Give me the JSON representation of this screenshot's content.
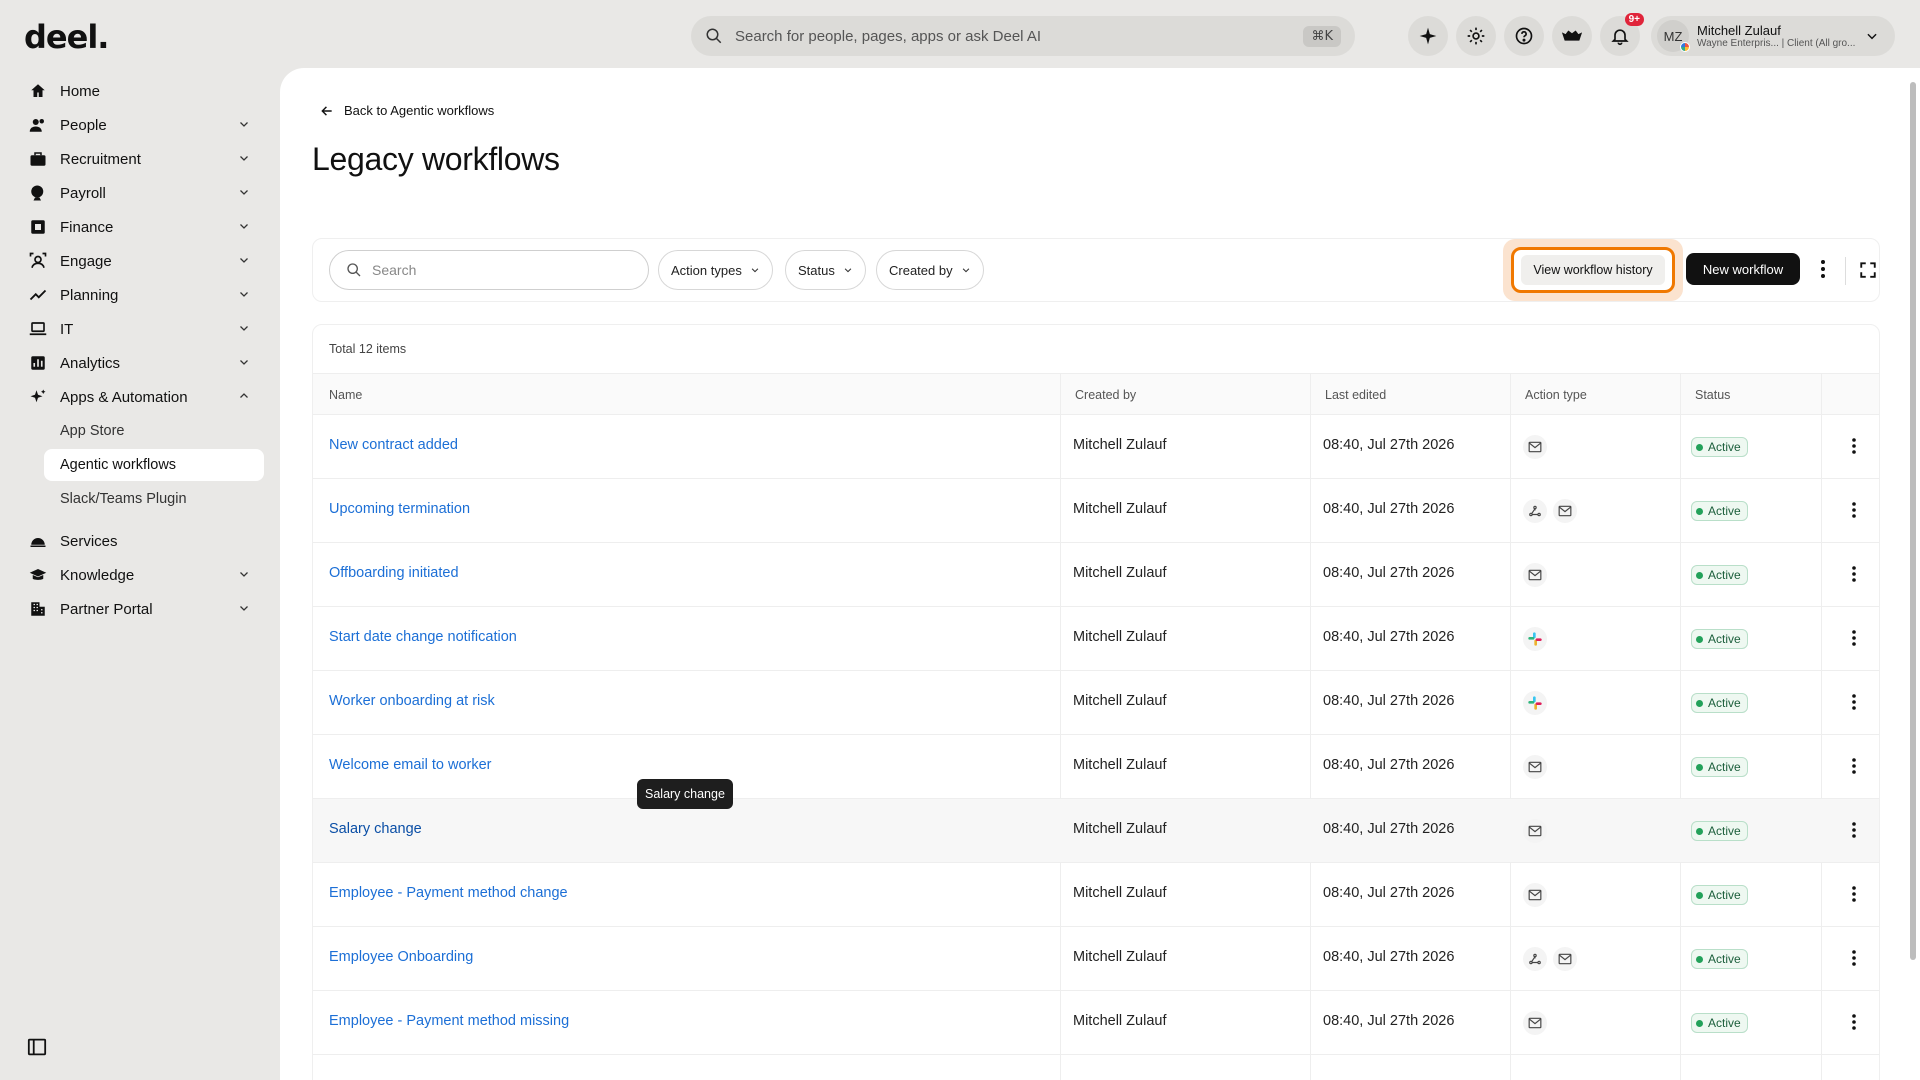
{
  "app": {
    "logo": "deel."
  },
  "search": {
    "placeholder": "Search for people, pages, apps or ask Deel AI",
    "shortcut": "⌘K"
  },
  "topbar": {
    "notification_count": "9+"
  },
  "user": {
    "initials": "MZ",
    "name": "Mitchell Zulauf",
    "subtitle": "Wayne Enterpris... | Client (All gro..."
  },
  "sidebar": {
    "items": [
      {
        "label": "Home",
        "icon": "home-icon"
      },
      {
        "label": "People",
        "icon": "people-icon"
      },
      {
        "label": "Recruitment",
        "icon": "briefcase-icon"
      },
      {
        "label": "Payroll",
        "icon": "payroll-icon"
      },
      {
        "label": "Finance",
        "icon": "finance-icon"
      },
      {
        "label": "Engage",
        "icon": "engage-icon"
      },
      {
        "label": "Planning",
        "icon": "planning-icon"
      },
      {
        "label": "IT",
        "icon": "laptop-icon"
      },
      {
        "label": "Analytics",
        "icon": "analytics-icon"
      },
      {
        "label": "Apps & Automation",
        "icon": "sparkle-icon"
      }
    ],
    "sub_items": [
      "App Store",
      "Agentic workflows",
      "Slack/Teams Plugin"
    ],
    "bottom_items": [
      {
        "label": "Services",
        "icon": "services-icon"
      },
      {
        "label": "Knowledge",
        "icon": "knowledge-icon"
      },
      {
        "label": "Partner Portal",
        "icon": "building-icon"
      }
    ]
  },
  "page": {
    "back_link": "Back to Agentic workflows",
    "title": "Legacy workflows"
  },
  "toolbar": {
    "search_placeholder": "Search",
    "filters": [
      "Action types",
      "Status",
      "Created by"
    ],
    "history_button": "View workflow history",
    "new_button": "New workflow"
  },
  "table": {
    "total": "Total 12 items",
    "columns": [
      "Name",
      "Created by",
      "Last edited",
      "Action type",
      "Status"
    ],
    "rows": [
      {
        "name": "New contract added",
        "created_by": "Mitchell Zulauf",
        "last_edited": "08:40, Jul 27th 2026",
        "actions": [
          "mail-icon"
        ],
        "status": "Active"
      },
      {
        "name": "Upcoming termination",
        "created_by": "Mitchell Zulauf",
        "last_edited": "08:40, Jul 27th 2026",
        "actions": [
          "webhook-icon",
          "mail-icon"
        ],
        "status": "Active"
      },
      {
        "name": "Offboarding initiated",
        "created_by": "Mitchell Zulauf",
        "last_edited": "08:40, Jul 27th 2026",
        "actions": [
          "mail-icon"
        ],
        "status": "Active"
      },
      {
        "name": "Start date change notification",
        "created_by": "Mitchell Zulauf",
        "last_edited": "08:40, Jul 27th 2026",
        "actions": [
          "slack-icon"
        ],
        "status": "Active"
      },
      {
        "name": "Worker onboarding at risk",
        "created_by": "Mitchell Zulauf",
        "last_edited": "08:40, Jul 27th 2026",
        "actions": [
          "slack-icon"
        ],
        "status": "Active"
      },
      {
        "name": "Welcome email to worker",
        "created_by": "Mitchell Zulauf",
        "last_edited": "08:40, Jul 27th 2026",
        "actions": [
          "mail-icon"
        ],
        "status": "Active"
      },
      {
        "name": "Salary change",
        "created_by": "Mitchell Zulauf",
        "last_edited": "08:40, Jul 27th 2026",
        "actions": [
          "mail-icon"
        ],
        "status": "Active"
      },
      {
        "name": "Employee - Payment method change",
        "created_by": "Mitchell Zulauf",
        "last_edited": "08:40, Jul 27th 2026",
        "actions": [
          "mail-icon"
        ],
        "status": "Active"
      },
      {
        "name": "Employee Onboarding",
        "created_by": "Mitchell Zulauf",
        "last_edited": "08:40, Jul 27th 2026",
        "actions": [
          "webhook-icon",
          "mail-icon"
        ],
        "status": "Active"
      },
      {
        "name": "Employee - Payment method missing",
        "created_by": "Mitchell Zulauf",
        "last_edited": "08:40, Jul 27th 2026",
        "actions": [
          "mail-icon"
        ],
        "status": "Active"
      }
    ]
  },
  "tooltip": {
    "text": "Salary change"
  },
  "colors": {
    "accent_link": "#1c6fd6",
    "focus_ring": "#f07800",
    "active_green": "#23a15a",
    "notification": "#e0243a"
  }
}
